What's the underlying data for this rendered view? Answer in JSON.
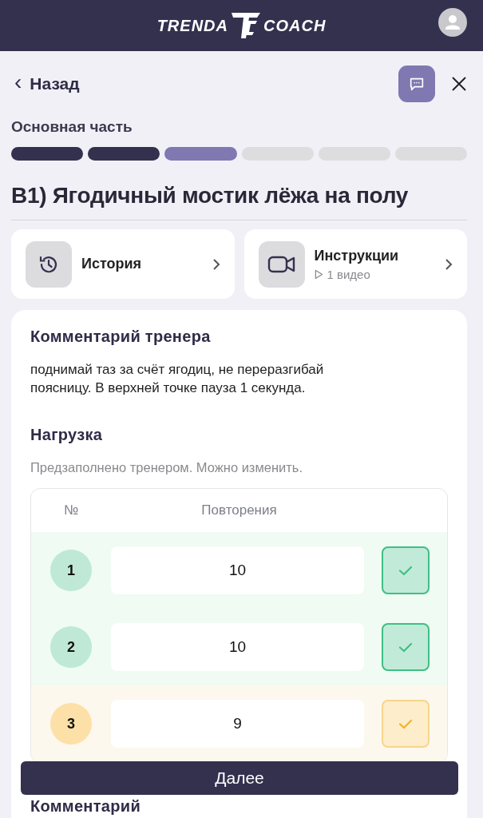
{
  "header": {
    "logo_left": "TRENDA",
    "logo_right": "COACH"
  },
  "nav": {
    "back": "Назад",
    "back_icon": "‹"
  },
  "section": {
    "title": "Основная часть",
    "steps": [
      {
        "completed": true,
        "selected": false
      },
      {
        "completed": true,
        "selected": false
      },
      {
        "completed": false,
        "selected": true
      },
      {
        "completed": false,
        "selected": false
      },
      {
        "completed": false,
        "selected": false
      },
      {
        "completed": false,
        "selected": false
      }
    ]
  },
  "exercise_title": "B1) Ягодичный мостик лёжа на полу",
  "links": [
    {
      "kind": "history",
      "label": "История"
    },
    {
      "kind": "video",
      "label": "Инструкции",
      "sub": "1 видео"
    }
  ],
  "coach_comment": {
    "title": "Комментарий тренера",
    "text": "поднимай таз за счёт ягодиц, не переразгибай поясницу. В верхней точке пауза 1 секунда."
  },
  "load": {
    "title": "Нагрузка",
    "hint": "Предзаполнено тренером. Можно изменить.",
    "columns": [
      "№",
      "Повторения"
    ],
    "rows": [
      {
        "number": "1",
        "reps": "10",
        "complete": true,
        "checked": true
      },
      {
        "number": "2",
        "reps": "10",
        "complete": true,
        "checked": true
      },
      {
        "number": "3",
        "reps": "9",
        "complete": false,
        "checked": true
      }
    ]
  },
  "next_section_title": "Комментарий",
  "next_button": "Далее"
}
